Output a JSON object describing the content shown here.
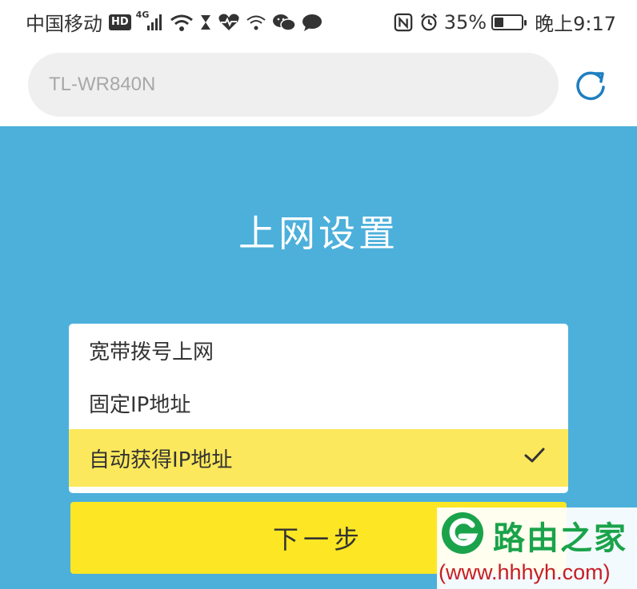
{
  "status_bar": {
    "carrier": "中国移动",
    "hd_badge": "HD",
    "network": "4G",
    "battery_percent": "35%",
    "battery_level": 0.35,
    "time": "晚上9:17",
    "icons": [
      "signal-icon",
      "wifi-icon",
      "hourglass-icon",
      "health-icon",
      "wifi-assist-icon",
      "wechat-icon",
      "message-icon",
      "nfc-icon",
      "alarm-icon",
      "battery-icon"
    ]
  },
  "address_bar": {
    "url": "TL-WR840N",
    "reload_icon": "reload-icon"
  },
  "page": {
    "title": "上网设置",
    "options": [
      {
        "label": "宽带拨号上网",
        "selected": false
      },
      {
        "label": "固定IP地址",
        "selected": false
      },
      {
        "label": "自动获得IP地址",
        "selected": true
      }
    ],
    "next_button": "下一步"
  },
  "watermark": {
    "name": "路由之家",
    "url": "(www.hhhyh.com)"
  },
  "colors": {
    "panel_bg": "#4cb0db",
    "selected_bg": "#fce85c",
    "button_bg": "#fde624",
    "accent": "#1f7fc0"
  }
}
